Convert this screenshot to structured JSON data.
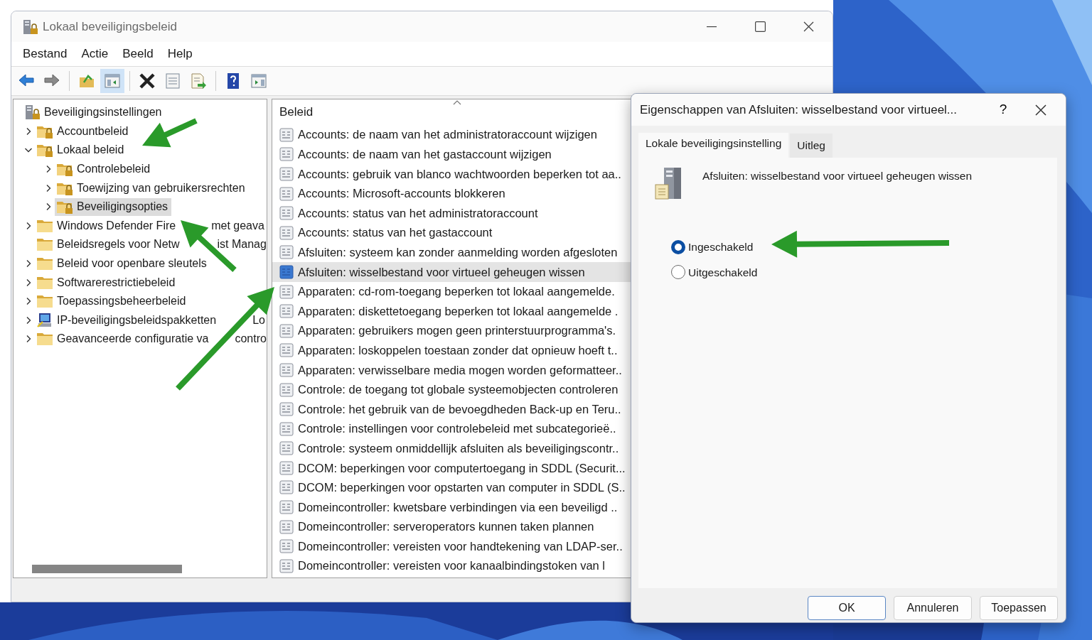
{
  "window": {
    "title": "Lokaal beveiligingsbeleid"
  },
  "menu": [
    "Bestand",
    "Actie",
    "Beeld",
    "Help"
  ],
  "toolbar": [
    {
      "kind": "back",
      "selected": false
    },
    {
      "kind": "forward",
      "selected": false
    },
    {
      "kind": "sep"
    },
    {
      "kind": "up",
      "selected": false
    },
    {
      "kind": "tree",
      "selected": true
    },
    {
      "kind": "sep"
    },
    {
      "kind": "delete",
      "selected": false
    },
    {
      "kind": "properties",
      "selected": false
    },
    {
      "kind": "export",
      "selected": false
    },
    {
      "kind": "sep"
    },
    {
      "kind": "help",
      "selected": false
    },
    {
      "kind": "pane",
      "selected": false
    }
  ],
  "tree": [
    {
      "label": "Beveiligingsinstellingen",
      "kind": "root",
      "selected": false,
      "children": [
        {
          "label": "Accountbeleid",
          "kind": "locked-folder",
          "expandable": true,
          "expanded": false,
          "selected": false
        },
        {
          "label": "Lokaal beleid",
          "kind": "locked-folder",
          "expandable": true,
          "expanded": true,
          "selected": false,
          "children": [
            {
              "label": "Controlebeleid",
              "kind": "locked-folder",
              "expandable": true,
              "expanded": false,
              "selected": false
            },
            {
              "label": "Toewijzing van gebruikersrechten",
              "kind": "locked-folder",
              "expandable": true,
              "expanded": false,
              "selected": false
            },
            {
              "label": "Beveiligingsopties",
              "kind": "locked-folder",
              "expandable": true,
              "expanded": false,
              "selected": true
            }
          ]
        },
        {
          "label": "Windows Defender Fire",
          "tail": "met geava",
          "kind": "folder",
          "expandable": true,
          "expanded": false,
          "selected": false
        },
        {
          "label": "Beleidsregels voor Netw",
          "tail": "ist Manag",
          "kind": "folder",
          "expandable": false,
          "selected": false
        },
        {
          "label": "Beleid voor openbare sleutels",
          "kind": "folder",
          "expandable": true,
          "expanded": false,
          "selected": false
        },
        {
          "label": "Softwarerestrictiebeleid",
          "kind": "folder",
          "expandable": true,
          "expanded": false,
          "selected": false
        },
        {
          "label": "Toepassingsbeheerbeleid",
          "kind": "folder",
          "expandable": true,
          "expanded": false,
          "selected": false
        },
        {
          "label": "IP-beveiligingsbeleidspakketten",
          "tail": "Lo",
          "kind": "network",
          "expandable": true,
          "expanded": false,
          "selected": false
        },
        {
          "label": "Geavanceerde configuratie va",
          "tail": "contro",
          "kind": "folder",
          "expandable": true,
          "expanded": false,
          "selected": false
        }
      ]
    }
  ],
  "list": {
    "column": "Beleid",
    "rows": [
      {
        "label": "Accounts: de naam van het administratoraccount wijzigen",
        "selected": false
      },
      {
        "label": "Accounts: de naam van het gastaccount wijzigen",
        "selected": false
      },
      {
        "label": "Accounts: gebruik van blanco wachtwoorden beperken tot aa..",
        "selected": false
      },
      {
        "label": "Accounts: Microsoft-accounts blokkeren",
        "selected": false
      },
      {
        "label": "Accounts: status van het administratoraccount",
        "selected": false
      },
      {
        "label": "Accounts: status van het gastaccount",
        "selected": false
      },
      {
        "label": "Afsluiten: systeem kan zonder aanmelding worden afgesloten",
        "selected": false
      },
      {
        "label": "Afsluiten: wisselbestand voor virtueel geheugen wissen",
        "selected": true
      },
      {
        "label": "Apparaten: cd-rom-toegang beperken tot lokaal aangemelde.",
        "selected": false
      },
      {
        "label": "Apparaten: diskettetoegang beperken tot lokaal aangemelde .",
        "selected": false
      },
      {
        "label": "Apparaten: gebruikers mogen geen printerstuurprogramma's.",
        "selected": false
      },
      {
        "label": "Apparaten: loskoppelen toestaan zonder dat opnieuw hoeft t..",
        "selected": false
      },
      {
        "label": "Apparaten: verwisselbare media mogen worden geformatteer..",
        "selected": false
      },
      {
        "label": "Controle: de toegang tot globale systeemobjecten controleren",
        "selected": false
      },
      {
        "label": "Controle: het gebruik van de bevoegdheden Back-up en Teru..",
        "selected": false
      },
      {
        "label": "Controle: instellingen voor controlebeleid met subcategorieë..",
        "selected": false
      },
      {
        "label": "Controle: systeem onmiddellijk afsluiten als beveiligingscontr..",
        "selected": false
      },
      {
        "label": "DCOM: beperkingen voor computertoegang in SDDL (Securit...",
        "selected": false
      },
      {
        "label": "DCOM: beperkingen voor opstarten van computer in SDDL (S..",
        "selected": false
      },
      {
        "label": "Domeincontroller: kwetsbare verbindingen via een beveiligd ..",
        "selected": false
      },
      {
        "label": "Domeincontroller: serveroperators kunnen taken plannen",
        "selected": false
      },
      {
        "label": "Domeincontroller: vereisten voor handtekening van LDAP-ser..",
        "selected": false
      },
      {
        "label": "Domeincontroller: vereisten voor kanaalbindingstoken van l",
        "selected": false
      }
    ]
  },
  "dialog": {
    "title": "Eigenschappen van Afsluiten: wisselbestand voor virtueel...",
    "help": "?",
    "tabs": [
      {
        "label": "Lokale beveiligingsinstelling",
        "selected": true
      },
      {
        "label": "Uitleg",
        "selected": false
      }
    ],
    "setting": "Afsluiten: wisselbestand voor virtueel geheugen wissen",
    "options": [
      {
        "label": "Ingeschakeld",
        "selected": true
      },
      {
        "label": "Uitgeschakeld",
        "selected": false
      }
    ],
    "buttons": [
      {
        "label": "OK",
        "default": true
      },
      {
        "label": "Annuleren",
        "default": false
      },
      {
        "label": "Toepassen",
        "default": false
      }
    ]
  }
}
